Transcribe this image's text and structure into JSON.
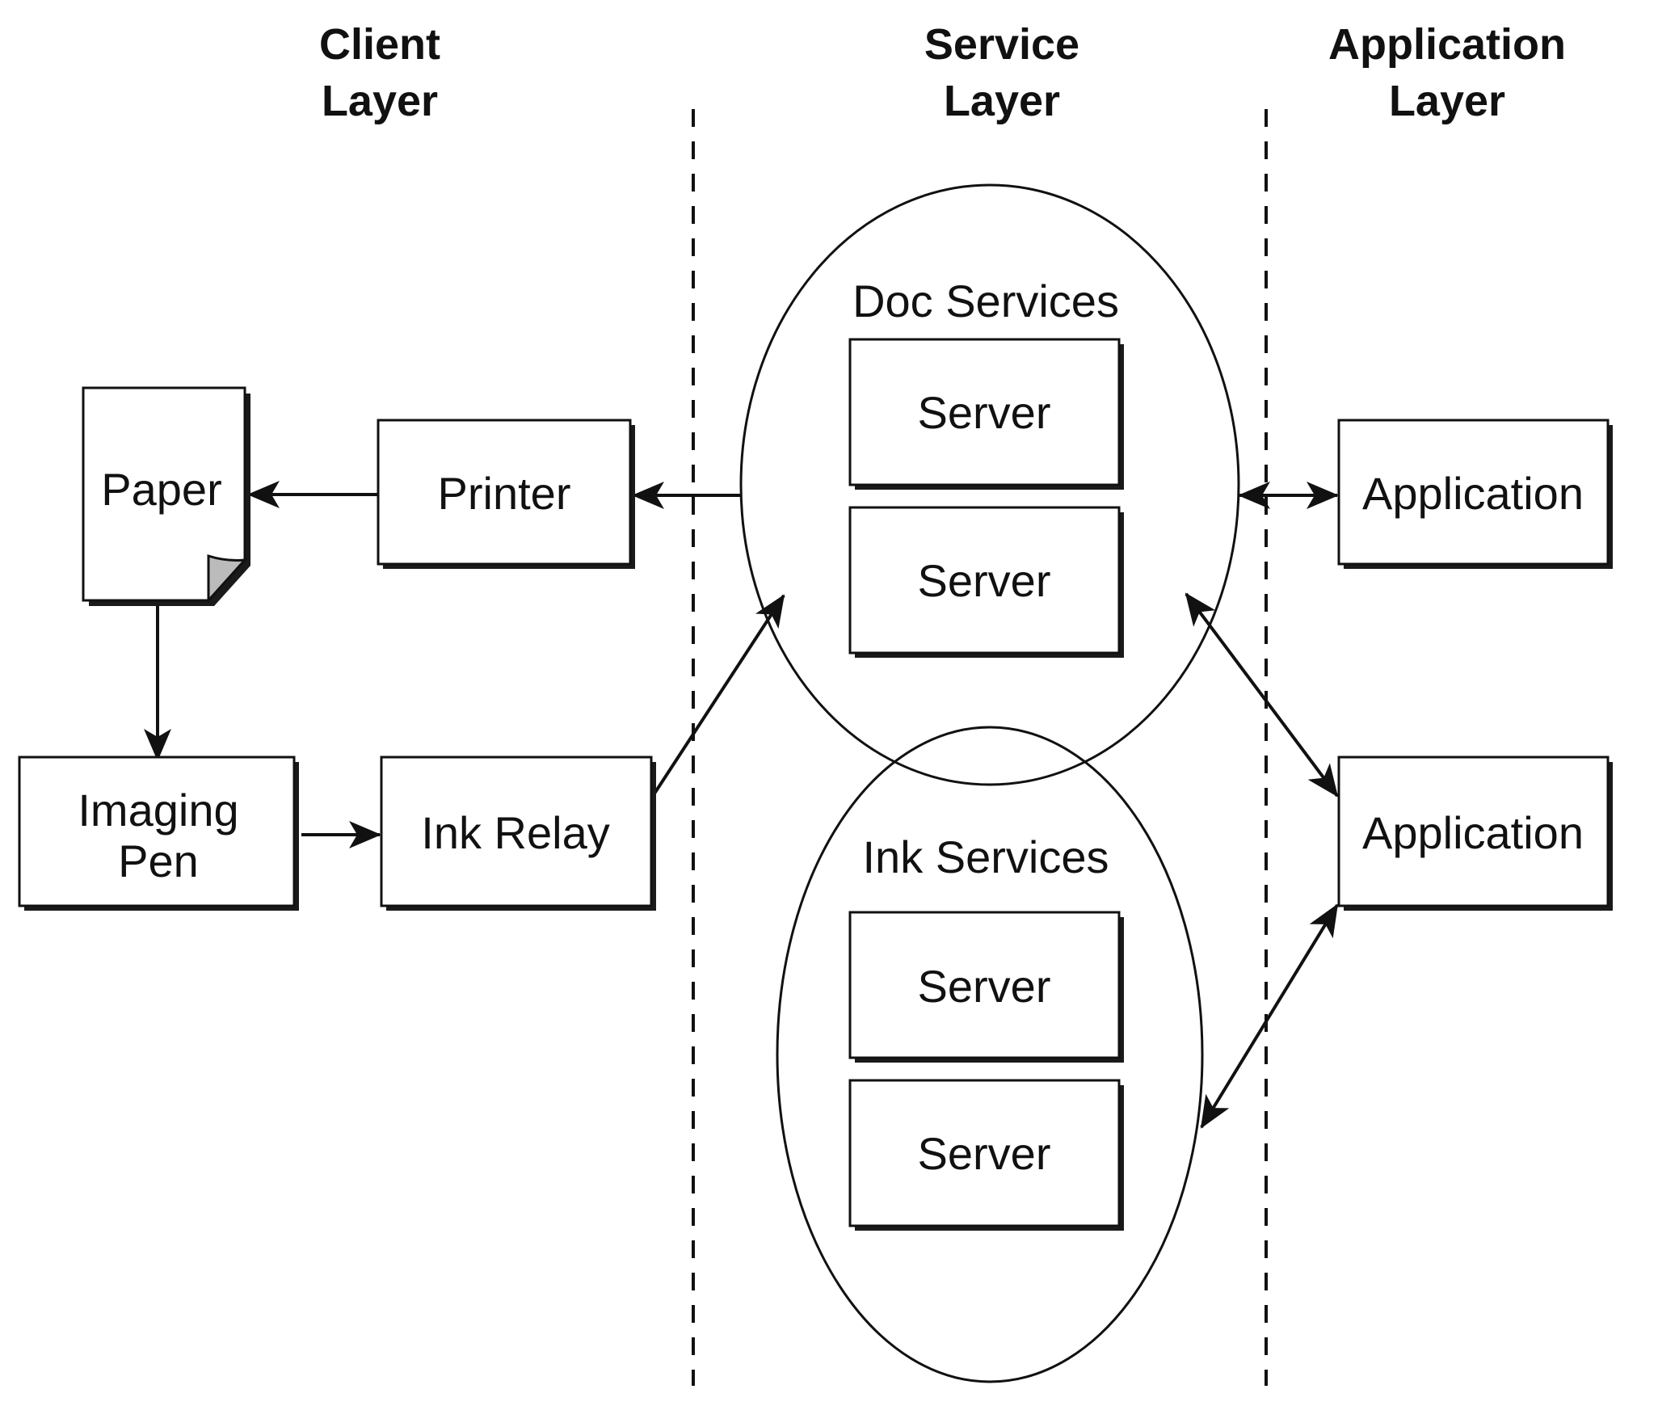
{
  "layers": [
    {
      "id": "client",
      "line1": "Client",
      "line2": "Layer"
    },
    {
      "id": "service",
      "line1": "Service",
      "line2": "Layer"
    },
    {
      "id": "application",
      "line1": "Application",
      "line2": "Layer"
    }
  ],
  "client": {
    "paper": "Paper",
    "printer": "Printer",
    "imaging_pen_line1": "Imaging",
    "imaging_pen_line2": "Pen",
    "ink_relay": "Ink Relay"
  },
  "service": {
    "doc_services": {
      "title": "Doc Services",
      "servers": [
        "Server",
        "Server"
      ]
    },
    "ink_services": {
      "title": "Ink Services",
      "servers": [
        "Server",
        "Server"
      ]
    }
  },
  "application": {
    "apps": [
      "Application",
      "Application"
    ]
  },
  "connections": [
    {
      "from": "Printer",
      "to": "Paper",
      "direction": "one-way"
    },
    {
      "from": "Doc Services",
      "to": "Printer",
      "direction": "one-way"
    },
    {
      "from": "Paper",
      "to": "Imaging Pen",
      "direction": "one-way"
    },
    {
      "from": "Imaging Pen",
      "to": "Ink Relay",
      "direction": "one-way"
    },
    {
      "from": "Ink Relay",
      "to": "Doc Services",
      "direction": "one-way"
    },
    {
      "from": "Doc Services",
      "to": "Application 1",
      "direction": "two-way"
    },
    {
      "from": "Doc Services",
      "to": "Application 2",
      "direction": "two-way"
    },
    {
      "from": "Ink Services",
      "to": "Application 2",
      "direction": "two-way"
    }
  ]
}
